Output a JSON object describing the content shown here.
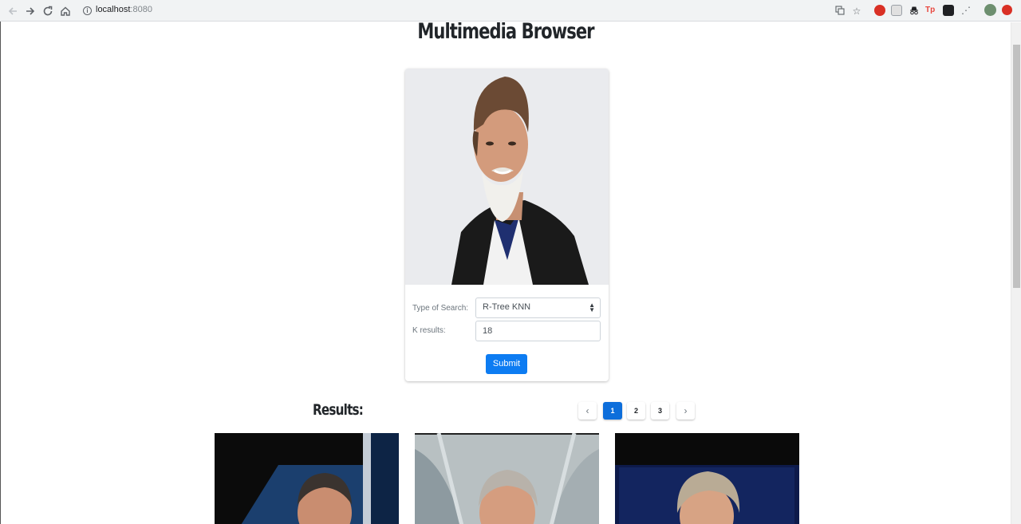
{
  "browser": {
    "url_host": "localhost",
    "url_port": ":8080",
    "extension_colors": [
      "#d93025",
      "#9aa0a6",
      "#202124",
      "#e8453c",
      "#202124",
      "#5f6368",
      "#6d8f6f",
      "#d93025"
    ]
  },
  "page": {
    "title": "Multimedia Browser"
  },
  "search_form": {
    "type_label": "Type of Search:",
    "type_value": "R-Tree KNN",
    "k_label": "K results:",
    "k_value": "18",
    "submit_label": "Submit"
  },
  "results": {
    "title": "Results:",
    "pages": [
      "1",
      "2",
      "3"
    ],
    "active_page": "1",
    "prev_label": "‹",
    "next_label": "›"
  }
}
